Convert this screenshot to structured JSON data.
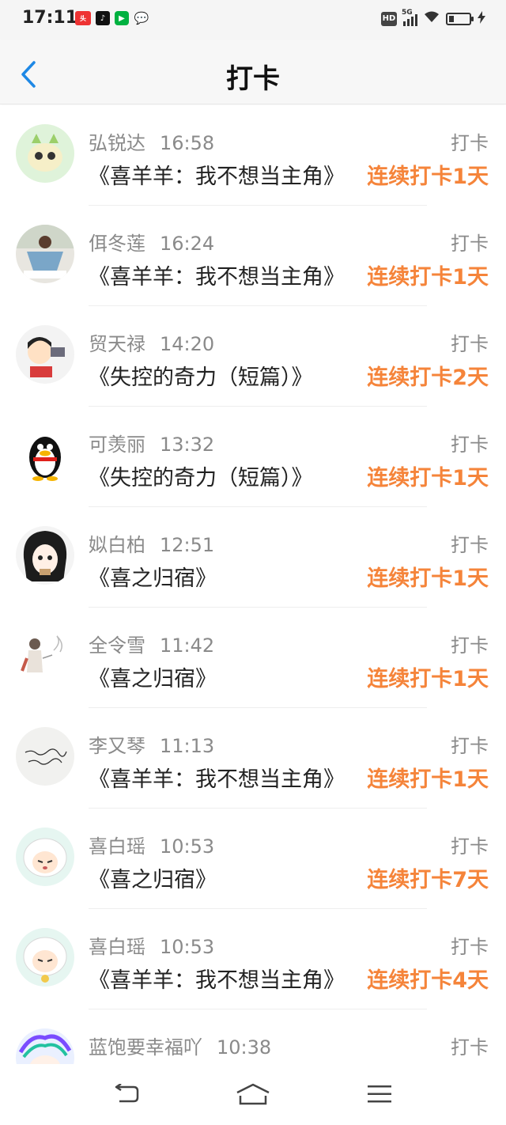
{
  "status_bar": {
    "time": "17:11",
    "notification_icons": [
      "toutiao-icon",
      "tiktok-icon",
      "iqiyi-icon",
      "wechat-icon"
    ],
    "hd_label": "HD",
    "network_label": "5G"
  },
  "header": {
    "title": "打卡"
  },
  "colors": {
    "accent_orange": "#f5843a",
    "back_blue": "#1e88e5",
    "meta_gray": "#8a8a8a"
  },
  "feed": [
    {
      "name": "弘锐达",
      "time": "16:58",
      "tag": "打卡",
      "book": "《喜羊羊：我不想当主角》",
      "streak": "连续打卡1天"
    },
    {
      "name": "佴冬莲",
      "time": "16:24",
      "tag": "打卡",
      "book": "《喜羊羊：我不想当主角》",
      "streak": "连续打卡1天"
    },
    {
      "name": "贸天禄",
      "time": "14:20",
      "tag": "打卡",
      "book": "《失控的奇力（短篇）》",
      "streak": "连续打卡2天"
    },
    {
      "name": "可羡丽",
      "time": "13:32",
      "tag": "打卡",
      "book": "《失控的奇力（短篇）》",
      "streak": "连续打卡1天"
    },
    {
      "name": "姒白柏",
      "time": "12:51",
      "tag": "打卡",
      "book": "《喜之归宿》",
      "streak": "连续打卡1天"
    },
    {
      "name": "全令雪",
      "time": "11:42",
      "tag": "打卡",
      "book": "《喜之归宿》",
      "streak": "连续打卡1天"
    },
    {
      "name": "李又琴",
      "time": "11:13",
      "tag": "打卡",
      "book": "《喜羊羊：我不想当主角》",
      "streak": "连续打卡1天"
    },
    {
      "name": "喜白瑶",
      "time": "10:53",
      "tag": "打卡",
      "book": "《喜之归宿》",
      "streak": "连续打卡7天"
    },
    {
      "name": "喜白瑶",
      "time": "10:53",
      "tag": "打卡",
      "book": "《喜羊羊：我不想当主角》",
      "streak": "连续打卡4天"
    },
    {
      "name": "蓝饱要幸福吖",
      "time": "10:38",
      "tag": "打卡",
      "book": "",
      "streak": ""
    }
  ],
  "nav": {
    "icons": [
      "back-nav-icon",
      "home-nav-icon",
      "menu-nav-icon"
    ]
  }
}
